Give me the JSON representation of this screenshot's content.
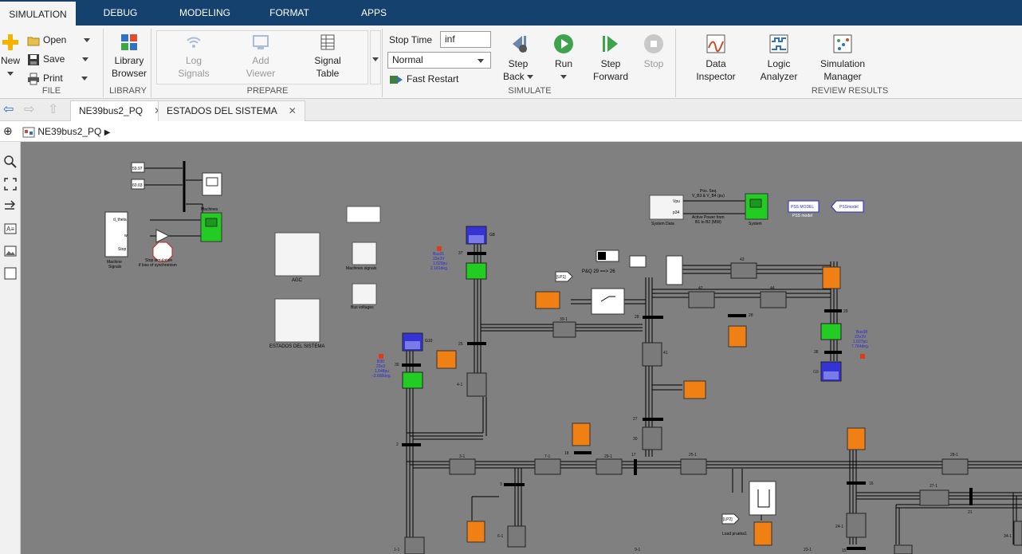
{
  "tabs": [
    "SIMULATION",
    "DEBUG",
    "MODELING",
    "FORMAT",
    "APPS"
  ],
  "ribbon": {
    "file": {
      "label": "FILE",
      "new_label": "New",
      "open_label": "Open",
      "save_label": "Save",
      "print_label": "Print"
    },
    "library": {
      "label": "LIBRARY",
      "browser_line1": "Library",
      "browser_line2": "Browser"
    },
    "prepare": {
      "label": "PREPARE",
      "log_line1": "Log",
      "log_line2": "Signals",
      "add_line1": "Add",
      "add_line2": "Viewer",
      "table_line1": "Signal",
      "table_line2": "Table"
    },
    "simulate": {
      "label": "SIMULATE",
      "stop_time_label": "Stop Time",
      "stop_time_value": "inf",
      "mode_value": "Normal",
      "fast_restart_label": "Fast Restart",
      "step_back_line1": "Step",
      "step_back_line2": "Back",
      "run_label": "Run",
      "step_fwd_line1": "Step",
      "step_fwd_line2": "Forward",
      "stop_label": "Stop"
    },
    "review": {
      "label": "REVIEW RESULTS",
      "data_line1": "Data",
      "data_line2": "Inspector",
      "logic_line1": "Logic",
      "logic_line2": "Analyzer",
      "sim_line1": "Simulation",
      "sim_line2": "Manager"
    }
  },
  "doc_tabs": [
    {
      "title": "NE39bus2_PQ"
    },
    {
      "title": "ESTADOS DEL SISTEMA"
    }
  ],
  "breadcrumb": "NE39bus2_PQ",
  "model": {
    "const1": "59.97",
    "const2": "60.03",
    "mux_in1": "d_theta",
    "mux_in2": "w",
    "mux_in3": "Stop",
    "machine_signals_line1": "Machine",
    "machine_signals_line2": "Signals",
    "stop_sim_line1": "Stop simulation",
    "stop_sim_line2": "if loss of synchronism",
    "machines_label": "Machines",
    "agc_label": "AGC",
    "estados_label": "ESTADOS DEL SISTEMA",
    "machines_signals_label": "Machines signals",
    "bus_voltages_label": "Bus voltages",
    "system_data_label": "System Data",
    "system_label": "System",
    "possseq_line1": "Pos. Seq.",
    "possseq_line2": "V_B3 & V_B4 (pu)",
    "active_power_line1": "Active Power from",
    "active_power_line2": "B1 to B2 (MW)",
    "vpu_port": "Vpu",
    "p34_port": "p34",
    "pss_model_block": "PSS MODEL",
    "pss_model_label": "PSS model",
    "pss_goto": "PSSmodel",
    "pq_label": "P&Q 29 ==> 26",
    "lp1": "[LP1]",
    "lp2": "[LP2]",
    "load_prueba_label": "Load prueba1",
    "g8": "G8",
    "g9": "G9",
    "g10": "G10",
    "bus31": [
      "Bus31",
      "22e3V",
      "1.029pu",
      "2.181deg."
    ],
    "bus30": [
      "B30",
      "22e3",
      "1.048pu",
      "-3.668deg."
    ],
    "bus38": [
      "Bus38",
      "22e3V",
      "1.027pu",
      "7.784deg."
    ],
    "nums": [
      "37",
      "30",
      "25",
      "39-1",
      "2",
      "4-1",
      "28",
      "41",
      "27",
      "30",
      "42",
      "43",
      "44",
      "29",
      "28",
      "38",
      "3-1",
      "7-1",
      "29-1",
      "17",
      "18",
      "25-1",
      "28-1",
      "3",
      "6-1",
      "16",
      "27-1",
      "21",
      "24-1",
      "34-1",
      "9-1",
      "23-1",
      "15",
      "1-1"
    ]
  }
}
